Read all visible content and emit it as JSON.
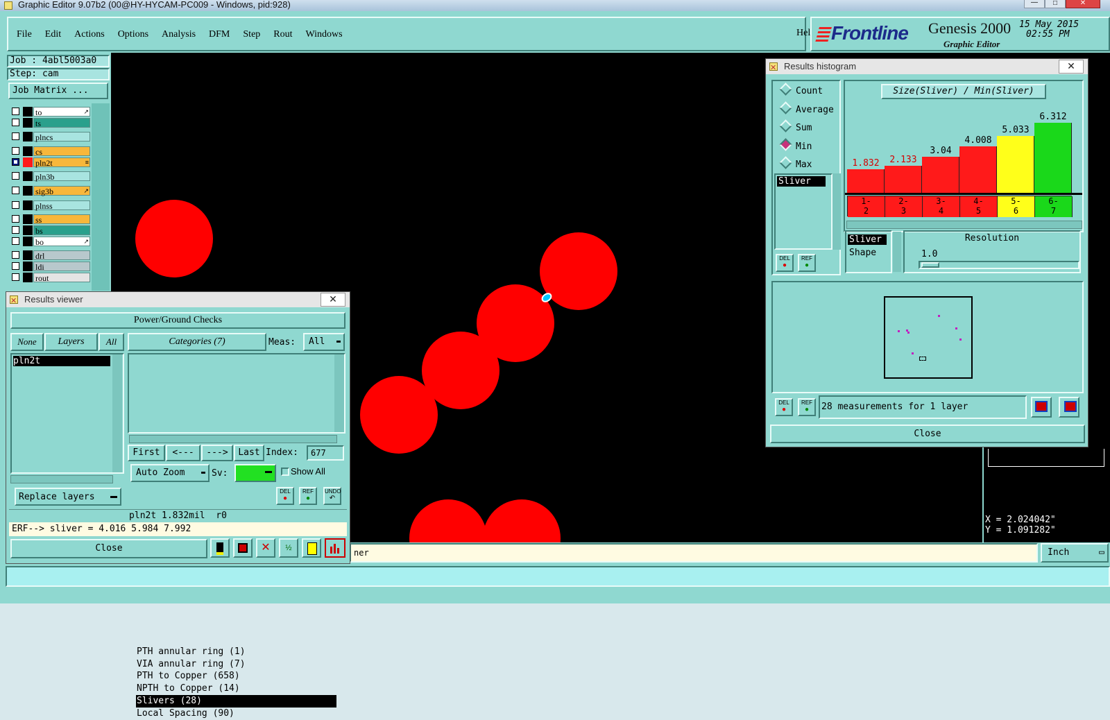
{
  "window_title": "Graphic Editor 9.07b2 (00@HY-HYCAM-PC009 - Windows, pid:928)",
  "menu": {
    "items": [
      "File",
      "Edit",
      "Actions",
      "Options",
      "Analysis",
      "DFM",
      "Step",
      "Rout",
      "Windows"
    ],
    "help": "Help"
  },
  "brand": {
    "logo": "Frontline",
    "product": "Genesis 2000",
    "subtitle": "Graphic Editor",
    "date": "15 May 2015",
    "time": "02:55 PM"
  },
  "job": {
    "job_label": "Job : 4abl5003a0",
    "step_label": "Step: cam",
    "matrix_button": "Job Matrix ..."
  },
  "layers": [
    {
      "name": "to",
      "color": "#ffffff",
      "mark": "#000000",
      "on": false,
      "icon": "arrow"
    },
    {
      "name": "ts",
      "color": "#2aa08c",
      "mark": "#000000",
      "on": false,
      "icon": ""
    },
    {
      "name": "plncs",
      "color": "#a8e4e0",
      "mark": "#000000",
      "on": false,
      "icon": ""
    },
    {
      "name": "cs",
      "color": "#f7b73b",
      "mark": "#000000",
      "on": false,
      "icon": ""
    },
    {
      "name": "pln2t",
      "color": "#f7b73b",
      "mark": "#ff1a1a",
      "on": true,
      "icon": "grip"
    },
    {
      "name": "pln3b",
      "color": "#a8e4e0",
      "mark": "#000000",
      "on": false,
      "icon": ""
    },
    {
      "name": "sig3b",
      "color": "#f7b73b",
      "mark": "#000000",
      "on": false,
      "icon": "arrow"
    },
    {
      "name": "plnss",
      "color": "#a8e4e0",
      "mark": "#000000",
      "on": false,
      "icon": ""
    },
    {
      "name": "ss",
      "color": "#f7b73b",
      "mark": "#000000",
      "on": false,
      "icon": ""
    },
    {
      "name": "bs",
      "color": "#2aa08c",
      "mark": "#000000",
      "on": false,
      "icon": ""
    },
    {
      "name": "bo",
      "color": "#ffffff",
      "mark": "#000000",
      "on": false,
      "icon": "arrow"
    },
    {
      "name": "drl",
      "color": "#b8c8cc",
      "mark": "#000000",
      "on": false,
      "icon": ""
    },
    {
      "name": "ldi",
      "color": "#b8c8cc",
      "mark": "#000000",
      "on": false,
      "icon": ""
    },
    {
      "name": "rout",
      "color": "#e4e4e4",
      "mark": "#000000",
      "on": false,
      "icon": ""
    }
  ],
  "results_viewer": {
    "title": "Results viewer",
    "header": "Power/Ground Checks",
    "filter_buttons": [
      "None",
      "Layers",
      "All"
    ],
    "layer_list": [
      "pln2t"
    ],
    "categories_button": "Categories (7)",
    "meas_label": "Meas:",
    "meas_value": "All",
    "categories": [
      "PTH annular ring (1)",
      "VIA annular ring (7)",
      "PTH to Copper (658)",
      "NPTH to Copper (14)",
      "Slivers (28)",
      "Local Spacing (90)"
    ],
    "selected_category": 4,
    "nav_buttons": [
      "First",
      "<---",
      "--->",
      "Last"
    ],
    "index_label": "Index:",
    "index_value": "677",
    "auto_zoom": "Auto Zoom",
    "sv_label": "Sv:",
    "show_all": "Show All",
    "replace_layers": "Replace layers",
    "icon_del": "DEL",
    "icon_ref": "REF",
    "icon_undo": "UNDO",
    "status_line": "pln2t 1.832mil  r0",
    "erf_line": "ERF--> sliver = 4.016 5.984 7.992",
    "close": "Close"
  },
  "histogram": {
    "title": "Results histogram",
    "radio_options": [
      "Count",
      "Average",
      "Sum",
      "Min",
      "Max"
    ],
    "selected_option": "Min",
    "measure_list": [
      "Sliver"
    ],
    "chart_title": "Size(Sliver) / Min(Sliver)",
    "resolution_label": "Resolution",
    "resolution_value": "1.0",
    "attr_list": [
      "Sliver",
      "Shape"
    ],
    "summary": "28 measurements for 1 layer",
    "close": "Close"
  },
  "chart_data": {
    "type": "bar",
    "title": "Size(Sliver) / Min(Sliver)",
    "categories": [
      "1-2",
      "2-3",
      "3-4",
      "4-5",
      "5-6",
      "6-7"
    ],
    "category_labels": [
      [
        "1-",
        "2"
      ],
      [
        "2-",
        "3"
      ],
      [
        "3-",
        "4"
      ],
      [
        "4-",
        "5"
      ],
      [
        "5-",
        "6"
      ],
      [
        "6-",
        "7"
      ]
    ],
    "values": [
      1.832,
      2.133,
      3.04,
      4.008,
      5.033,
      6.312
    ],
    "value_labels": [
      "1.832",
      "2.133",
      "3.04",
      "4.008",
      "5.033",
      "6.312"
    ],
    "colors": [
      "#ff1a1a",
      "#ff1a1a",
      "#ff1a1a",
      "#ff1a1a",
      "#ffff1a",
      "#1ad81a"
    ],
    "label_colors": [
      "#d40000",
      "#d40000",
      "#000000",
      "#000000",
      "#000000",
      "#000000"
    ],
    "ylim": [
      0,
      7
    ]
  },
  "bottom": {
    "command_hint": "ner",
    "units": "Inch",
    "x_readout": "X = 2.024042\"",
    "y_readout": "Y = 1.091282\""
  },
  "colors": {
    "canvas": "#000000",
    "feature": "#ff0000",
    "panel": "#8fd8d0",
    "highlight": "#00c8ff"
  }
}
